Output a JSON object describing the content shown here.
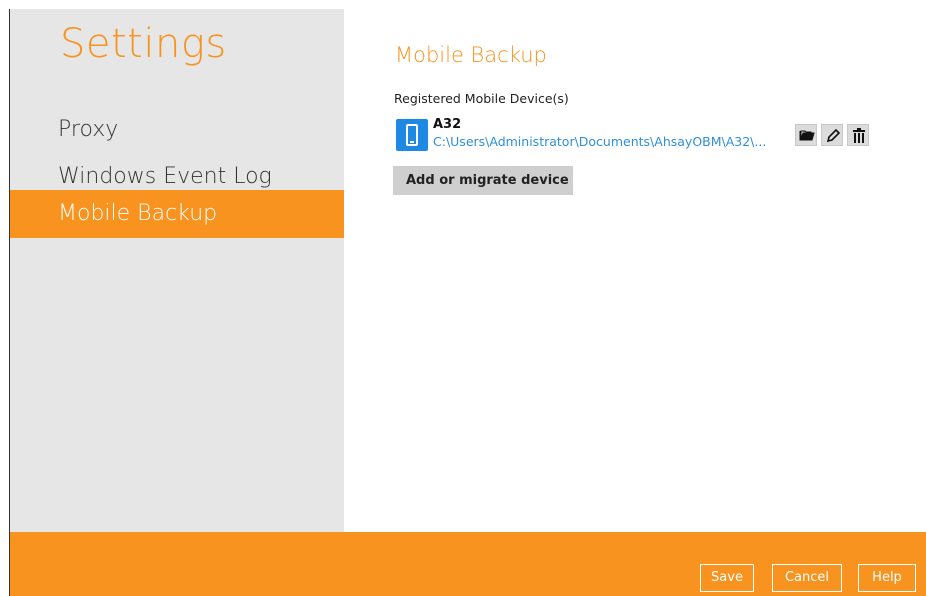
{
  "sidebar": {
    "title": "Settings",
    "items": [
      {
        "label": "Proxy",
        "active": false
      },
      {
        "label": "Windows Event Log",
        "active": false
      },
      {
        "label": "Mobile Backup",
        "active": true
      }
    ]
  },
  "main": {
    "title": "Mobile Backup",
    "section_label": "Registered Mobile Device(s)",
    "device": {
      "icon": "mobile-phone-icon",
      "name": "A32",
      "path": "C:\\Users\\Administrator\\Documents\\AhsayOBM\\A32\\..."
    },
    "actions": [
      "folder-open-icon",
      "pencil-icon",
      "trash-icon"
    ],
    "add_button": "Add or migrate device"
  },
  "footer": {
    "save": "Save",
    "cancel": "Cancel",
    "help": "Help"
  },
  "colors": {
    "accent": "#f7931e",
    "sidebar_bg": "#e6e6e6",
    "link": "#2f8fd8",
    "device_icon_bg": "#1e88e5"
  }
}
